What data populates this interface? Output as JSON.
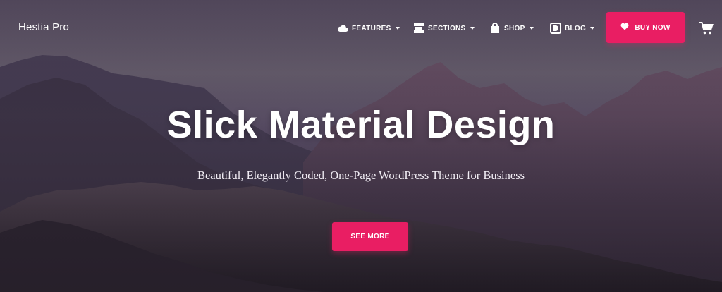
{
  "brand": "Hestia Pro",
  "nav": {
    "items": [
      {
        "label": "FEATURES",
        "icon": "cloud-icon"
      },
      {
        "label": "SECTIONS",
        "icon": "sections-icon"
      },
      {
        "label": "SHOP",
        "icon": "shop-bag-icon"
      },
      {
        "label": "BLOG",
        "icon": "blog-icon"
      }
    ],
    "buy_label": "BUY NOW",
    "cart_icon": "cart-icon"
  },
  "hero": {
    "title": "Slick Material Design",
    "subtitle": "Beautiful, Elegantly Coded, One-Page WordPress Theme for Business",
    "cta_label": "SEE MORE"
  },
  "colors": {
    "accent": "#e91e63",
    "text": "#ffffff"
  }
}
